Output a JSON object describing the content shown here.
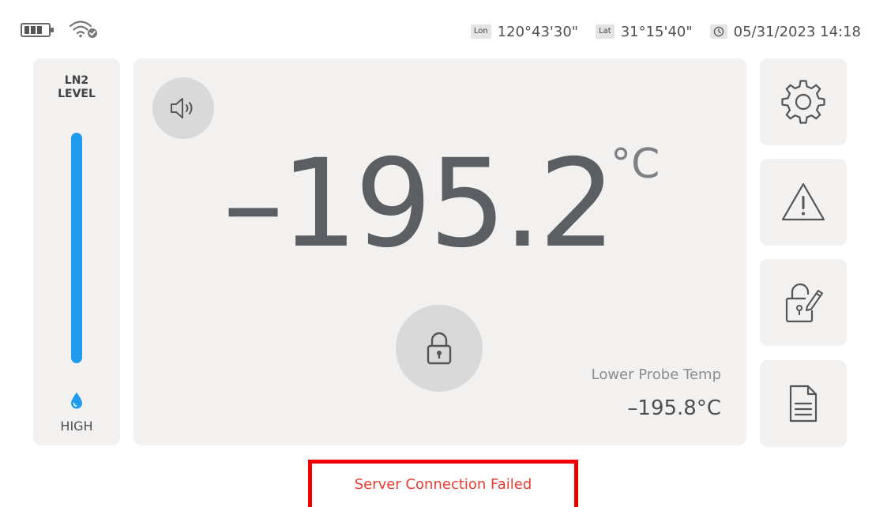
{
  "status_bar": {
    "battery_icon": "battery-icon",
    "wifi_icon": "wifi-icon",
    "lon_tag": "Lon",
    "lon_value": "120°43'30\"",
    "lat_tag": "Lat",
    "lat_value": "31°15'40\"",
    "clock_icon": "clock-icon",
    "datetime": "05/31/2023 14:18"
  },
  "ln2_panel": {
    "title_line1": "LN2",
    "title_line2": "LEVEL",
    "level_fraction": 1.0,
    "fill_color": "#1f9cf0",
    "drop_icon": "drop-icon",
    "status": "HIGH"
  },
  "main_panel": {
    "speaker_icon": "speaker-icon",
    "temperature": "–195.2",
    "unit": "°C",
    "lock_icon": "lock-icon",
    "probe_label": "Lower Probe Temp",
    "probe_value": "–195.8°C"
  },
  "side_buttons": [
    {
      "icon": "gear-icon"
    },
    {
      "icon": "warning-icon"
    },
    {
      "icon": "lock-edit-icon"
    },
    {
      "icon": "document-icon"
    }
  ],
  "error": {
    "message": "Server Connection Failed",
    "border_color": "#f20000",
    "text_color": "#ea3d2f"
  }
}
